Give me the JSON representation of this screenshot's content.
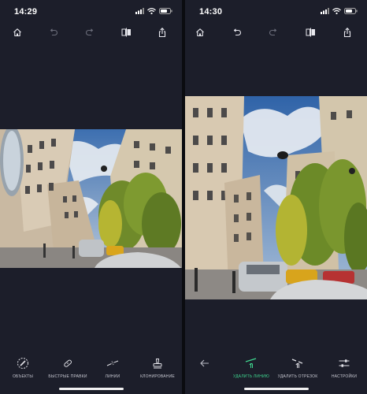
{
  "left_screen": {
    "status": {
      "time": "14:29"
    },
    "toolbar": {
      "icons": [
        "home-icon",
        "undo-icon",
        "redo-icon",
        "compare-icon",
        "share-icon"
      ]
    },
    "tools": [
      {
        "label": "ОБЪЕКТЫ",
        "icon": "eraser-circle-icon"
      },
      {
        "label": "БЫСТРЫЕ ПРАВКИ",
        "icon": "band-aid-icon"
      },
      {
        "label": "ЛИНИИ",
        "icon": "line-remove-icon"
      },
      {
        "label": "КЛОНИРОВАНИЕ",
        "icon": "stamp-icon"
      }
    ]
  },
  "right_screen": {
    "status": {
      "time": "14:30"
    },
    "toolbar": {
      "icons": [
        "home-icon",
        "undo-icon",
        "redo-icon",
        "compare-icon",
        "share-icon"
      ]
    },
    "tools": [
      {
        "label": "",
        "icon": "back-arrow-icon"
      },
      {
        "label": "УДАЛИТЬ ЛИНИЮ",
        "icon": "line-tap-icon",
        "active": true
      },
      {
        "label": "УДАЛИТЬ ОТРЕЗОК",
        "icon": "segment-tap-icon"
      },
      {
        "label": "НАСТРОЙКИ",
        "icon": "sliders-icon"
      }
    ]
  },
  "colors": {
    "background": "#1c1e2a",
    "accent": "#3fd68f",
    "text_muted": "#c8c9d2"
  }
}
